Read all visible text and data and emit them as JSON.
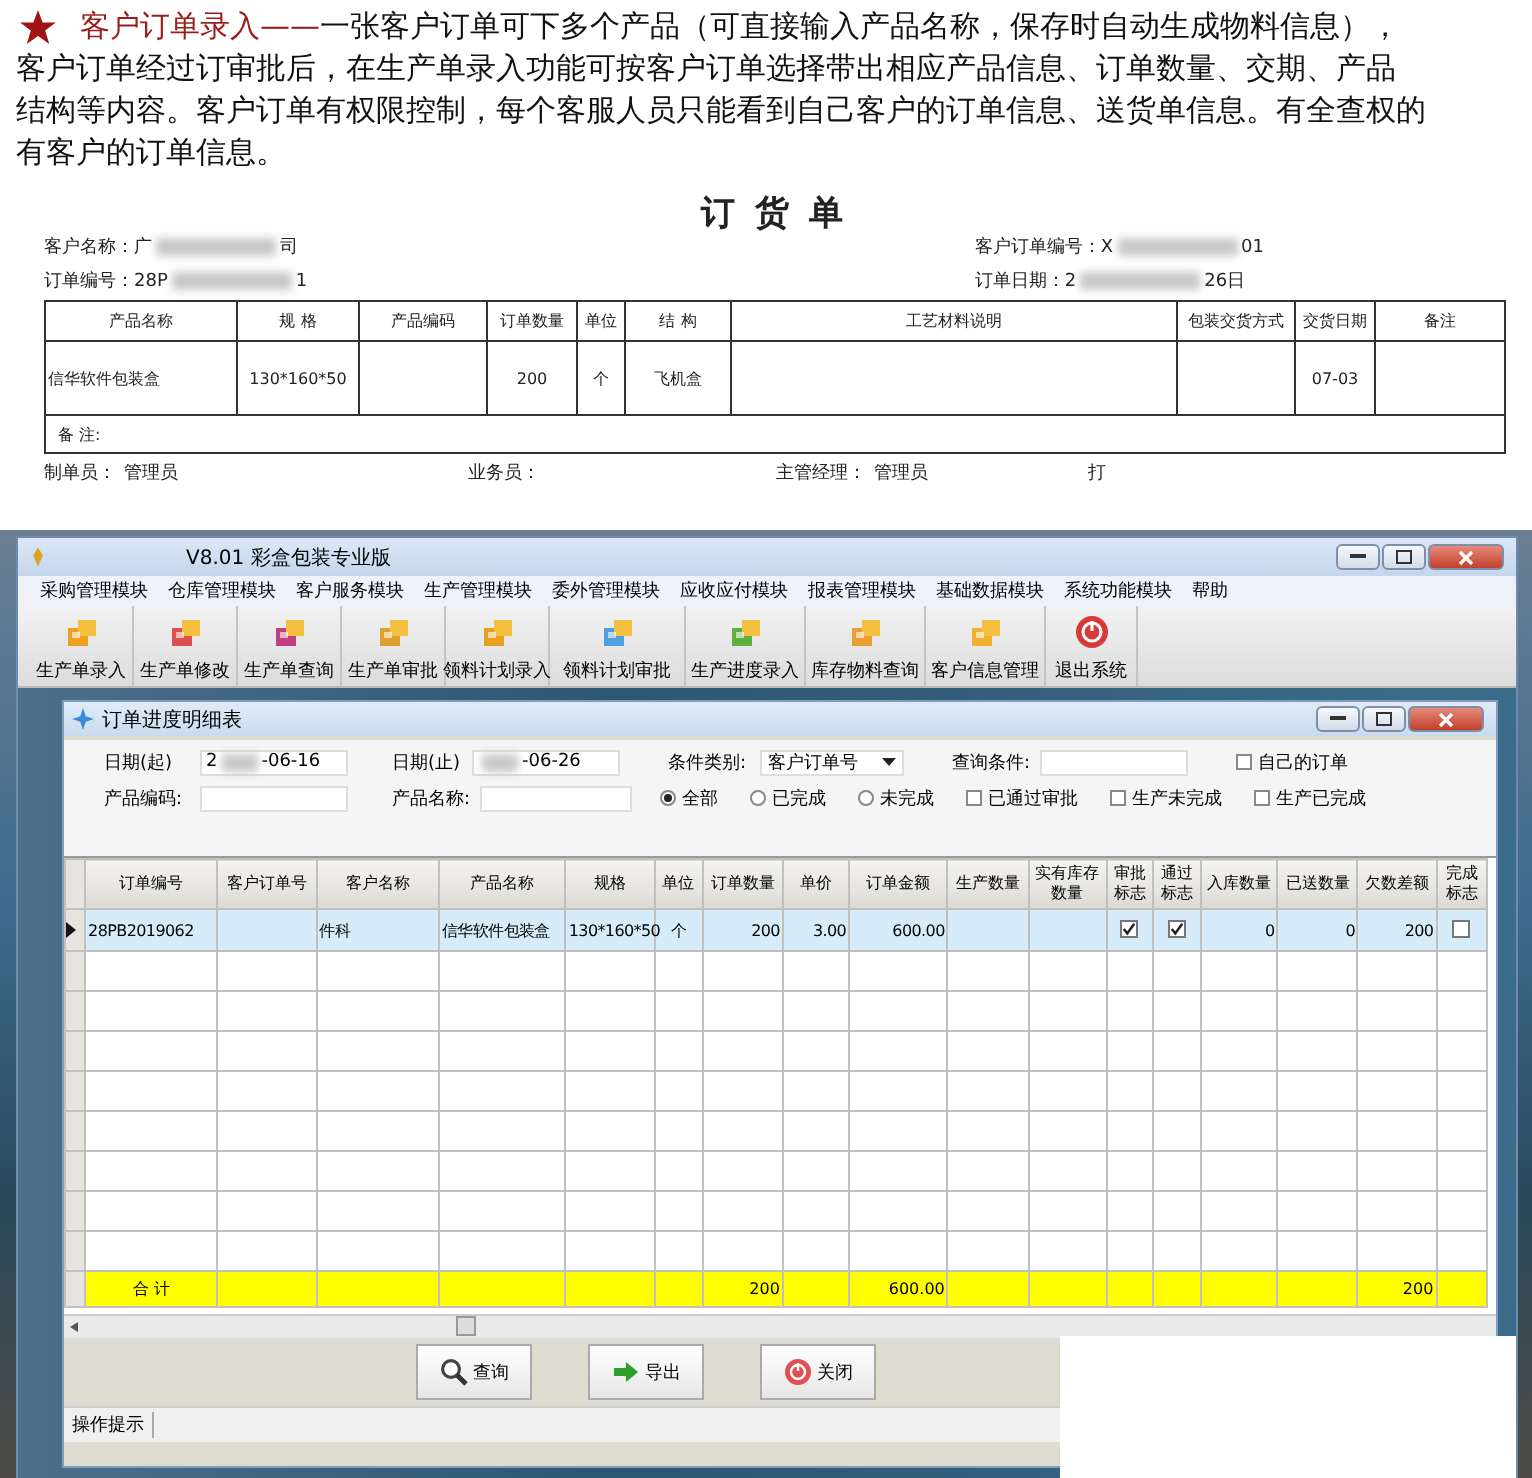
{
  "intro": {
    "title": "客户订单录入——",
    "lines": [
      "一张客户订单可下多个产品（可直接输入产品名称，保存时自动生成物料信息），",
      "客户订单经过订审批后，在生产单录入功能可按客户订单选择带出相应产品信息、订单数量、交期、产品",
      "结构等内容。客户订单有权限控制，每个客服人员只能看到自己客户的订单信息、送货单信息。有全查权的",
      "有客户的订单信息。"
    ]
  },
  "order_form": {
    "title": "订 货 单",
    "meta_left": [
      {
        "label": "客户名称：",
        "value": "广",
        "value_end": "司"
      },
      {
        "label": "订单编号：",
        "value": "28P",
        "value_end": "1"
      }
    ],
    "meta_right": [
      {
        "label": "客户订单编号：",
        "value": "X",
        "value_end": "01"
      },
      {
        "label": "订单日期：",
        "value": "2",
        "value_end": "26日"
      }
    ],
    "columns": [
      "产品名称",
      "规 格",
      "产品编码",
      "订单数量",
      "单位",
      "结 构",
      "工艺材料说明",
      "包装交货方式",
      "交货日期",
      "备注"
    ],
    "rows": [
      {
        "0": "信华软件包装盒",
        "1": "130*160*50",
        "3": "200",
        "4": "个",
        "5": "飞机盒",
        "8": "07-03"
      }
    ],
    "remark_label": "备 注:",
    "footer": [
      {
        "label": "制单员：",
        "value": "管理员"
      },
      {
        "label": "业务员："
      },
      {
        "label": "主管经理：",
        "value": "管理员"
      },
      {
        "label": "打"
      }
    ]
  },
  "app": {
    "title": "V8.01 彩盒包装专业版",
    "menu": [
      "采购管理模块",
      "仓库管理模块",
      "客户服务模块",
      "生产管理模块",
      "委外管理模块",
      "应收应付模块",
      "报表管理模块",
      "基础数据模块",
      "系统功能模块",
      "帮助"
    ],
    "toolbar": [
      {
        "label": "生产单录入",
        "kind": "module"
      },
      {
        "label": "生产单修改",
        "kind": "module"
      },
      {
        "label": "生产单查询",
        "kind": "module"
      },
      {
        "label": "生产单审批",
        "kind": "module"
      },
      {
        "label": "领料计划录入",
        "kind": "module"
      },
      {
        "label": "领料计划审批",
        "kind": "module"
      },
      {
        "label": "生产进度录入",
        "kind": "module"
      },
      {
        "label": "库存物料查询",
        "kind": "module"
      },
      {
        "label": "客户信息管理",
        "kind": "module"
      },
      {
        "label": "退出系统",
        "kind": "exit"
      }
    ],
    "child_window": {
      "title": "订单进度明细表",
      "date_from": {
        "label": "日期(起)",
        "value": "2",
        "value_end": "-06-16"
      },
      "date_to": {
        "label": "日期(止)",
        "value_end": "-06-26"
      },
      "condition_type": {
        "label": "条件类别:",
        "value": "客户订单号"
      },
      "query": {
        "label": "查询条件:"
      },
      "product_code": {
        "label": "产品编码:"
      },
      "product_name": {
        "label": "产品名称:"
      },
      "own_orders": {
        "label": "自己的订单",
        "checked": false
      },
      "radios": [
        {
          "label": "全部",
          "selected": true
        },
        {
          "label": "已完成",
          "selected": false
        },
        {
          "label": "未完成",
          "selected": false
        }
      ],
      "filters": [
        {
          "label": "已通过审批",
          "checked": false
        },
        {
          "label": "生产未完成",
          "checked": false
        },
        {
          "label": "生产已完成",
          "checked": false
        }
      ],
      "grid": {
        "columns": [
          "订单编号",
          "客户订单号",
          "客户名称",
          "产品名称",
          "规格",
          "单位",
          "订单数量",
          "单价",
          "订单金额",
          "生产数量",
          "实有库存数量",
          "审批标志",
          "通过标志",
          "入库数量",
          "已送数量",
          "欠数差额",
          "完成标志"
        ],
        "rows": [
          {
            "selected": true,
            "cells": {
              "0": "28PB2019062",
              "2": "件科",
              "3": "信华软件包装盒",
              "4": "130*160*50",
              "5": "个",
              "6": "200",
              "7": "3.00",
              "8": "600.00",
              "13": "0",
              "14": "0",
              "15": "200"
            },
            "approved": true,
            "passed": true,
            "completed": false
          }
        ],
        "total": {
          "0": "合 计",
          "6": "200",
          "8": "600.00",
          "15": "200"
        }
      },
      "buttons": [
        "查询",
        "导出",
        "关闭"
      ]
    },
    "status_bar": "操作提示"
  }
}
